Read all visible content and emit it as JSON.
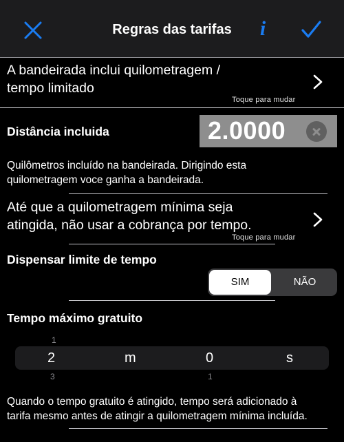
{
  "nav": {
    "title": "Regras das tarifas",
    "info_label": "i"
  },
  "rows": {
    "limited": {
      "line1": "A bandeirada inclui quilometragem /",
      "line2": "tempo limitado",
      "hint": "Toque para mudar"
    },
    "distance": {
      "label": "Distância incluida",
      "value": "2.0000",
      "desc_line1": "Quilômetros incluído na bandeirada. Dirigindo esta",
      "desc_line2": "quilometragem voce ganha a bandeirada."
    },
    "until": {
      "line1": "Até que a quilometragem mínima seja",
      "line2": "atingida, não usar a cobrança por tempo.",
      "hint": "Toque para mudar"
    },
    "waive": {
      "label": "Dispensar limite de tempo",
      "options": [
        "SIM",
        "NÃO"
      ],
      "selected": "SIM"
    },
    "max_free": {
      "label": "Tempo máximo gratuito",
      "picker": {
        "hours": "2",
        "hours_unit": "m",
        "minutes": "0",
        "minutes_unit": "s",
        "above_hours": "1",
        "below_hours": "3",
        "below_minutes": "1"
      },
      "desc_line1": "Quando o tempo gratuito é atingido, tempo será adicionado à",
      "desc_line2": "tarifa mesmo antes de atingir a quilometragem mínima incluída."
    }
  },
  "colors": {
    "accent": "#1a7cf2",
    "background": "#000000",
    "navbar": "#1c1c1e",
    "field": "#8e8e8e"
  }
}
